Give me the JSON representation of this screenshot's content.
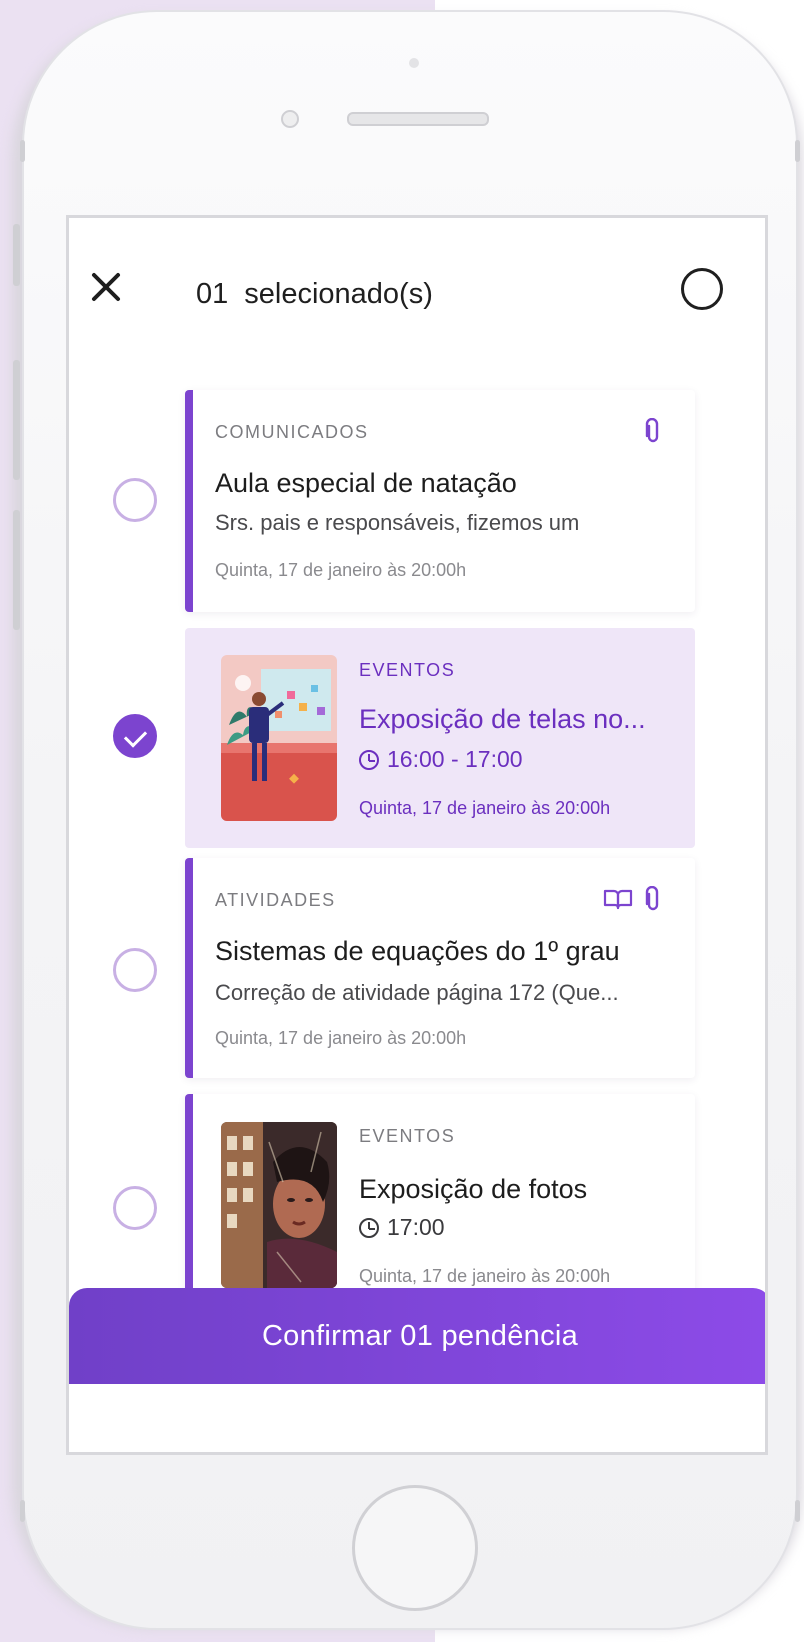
{
  "header": {
    "count": "01",
    "label": "selecionado(s)"
  },
  "items": [
    {
      "category": "COMUNICADOS",
      "title": "Aula especial de natação",
      "subtitle": "Srs. pais e responsáveis, fizemos um",
      "date": "Quinta, 17 de janeiro às 20:00h",
      "selected": false,
      "icons": [
        "paperclip-icon"
      ]
    },
    {
      "category": "EVENTOS",
      "title": "Exposição de telas no...",
      "time": "16:00 - 17:00",
      "date": "Quinta, 17 de janeiro às 20:00h",
      "selected": true,
      "icons": [
        "clock-icon"
      ]
    },
    {
      "category": "ATIVIDADES",
      "title": "Sistemas de equações do 1º grau",
      "subtitle": "Correção de atividade página 172 (Que...",
      "date": "Quinta, 17 de janeiro às 20:00h",
      "selected": false,
      "icons": [
        "book-icon",
        "paperclip-icon"
      ]
    },
    {
      "category": "EVENTOS",
      "title": "Exposição de fotos",
      "time": "17:00",
      "date": "Quinta, 17 de janeiro às 20:00h",
      "selected": false,
      "icons": [
        "clock-icon"
      ]
    }
  ],
  "confirm_button": "Confirmar 01 pendência",
  "colors": {
    "accent": "#7c44cf",
    "selected_bg": "#efe6f8",
    "background_tint": "#ebe1f2"
  }
}
